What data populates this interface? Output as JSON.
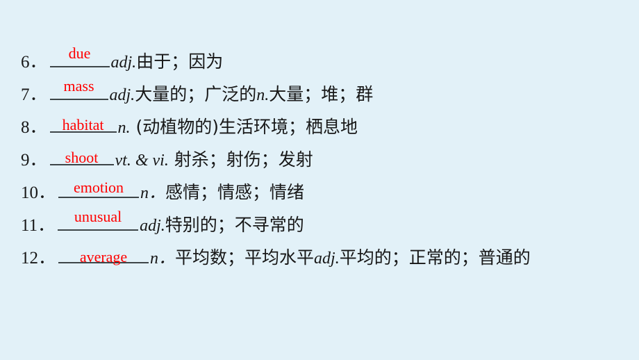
{
  "slide": {
    "background_color": "#e2f1f8",
    "answer_color": "#ff0000",
    "text_color": "#171717",
    "blank_rule_color": "#3d4548",
    "title": ""
  },
  "vocab": {
    "items": [
      {
        "index": "6．",
        "answer": "due",
        "slot_width": "86",
        "answer_position": "above",
        "pos": "adj.",
        "gloss": "由于；因为"
      },
      {
        "index": "7．",
        "answer": "mass",
        "slot_width": "84",
        "answer_position": "above",
        "pos": "adj.",
        "gloss": "大量的；广泛的",
        "pos2": "n.",
        "gloss2": "大量；堆；群"
      },
      {
        "index": "8．",
        "answer": "habitat",
        "slot_width": "96",
        "answer_position": "cross",
        "pos": "n.",
        "gloss": " (动植物的)生活环境；栖息地"
      },
      {
        "index": "9．",
        "answer": "shoot",
        "slot_width": "92",
        "answer_position": "cross",
        "pos": "vt. & vi.",
        "gloss": " 射杀；射伤；发射"
      },
      {
        "index": "10．",
        "answer": "emotion",
        "slot_width": "116",
        "answer_position": "on",
        "pos": "n．",
        "gloss": "感情；情感；情绪"
      },
      {
        "index": "11．",
        "answer": "unusual",
        "slot_width": "116",
        "answer_position": "above",
        "pos": "adj.",
        "gloss": "特别的；不寻常的"
      },
      {
        "index": "12．",
        "answer": "average",
        "slot_width": "130",
        "answer_position": "struck",
        "pos": "n．",
        "gloss": "平均数；平均水平",
        "pos2": "adj.",
        "gloss2": "平均的；正常的；普通的"
      }
    ]
  }
}
